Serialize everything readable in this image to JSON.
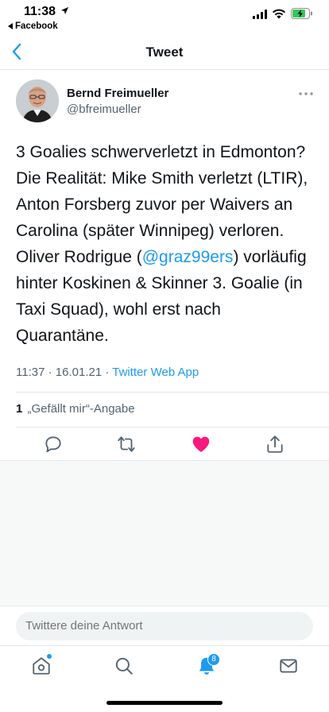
{
  "status_bar": {
    "time": "11:38",
    "back_app": "Facebook"
  },
  "header": {
    "title": "Tweet"
  },
  "tweet": {
    "author_name": "Bernd Freimueller",
    "author_handle": "@bfreimueller",
    "text_before": "3 Goalies schwerverletzt in Edmonton? Die Realität: Mike Smith verletzt (LTIR), Anton Forsberg zuvor per Waivers an Carolina (später Winnipeg) verloren. Oliver Rodrigue (",
    "mention": "@graz99ers",
    "text_after": ") vorläufig hinter Koskinen & Skinner 3. Goalie (in Taxi Squad), wohl erst nach Quarantäne.",
    "time": "11:37",
    "date": "16.01.21",
    "source": "Twitter Web App",
    "like_count": "1",
    "like_label": "„Gefällt mir“-Angabe"
  },
  "reply": {
    "placeholder": "Twittere deine Antwort"
  },
  "tab_bar": {
    "notification_badge": "8"
  },
  "colors": {
    "accent": "#1d9bf0",
    "like": "#f91880",
    "secondary_text": "#536471"
  }
}
